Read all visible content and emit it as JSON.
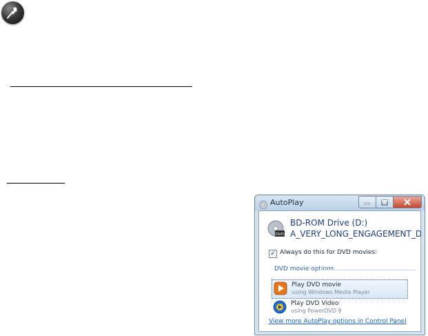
{
  "note": {
    "icon": "note-pin-icon"
  },
  "dialog": {
    "title": "AutoPlay",
    "title_icon": "autoplay-disc-icon",
    "drive_icon": "dvd-drive-icon",
    "drive_name": "BD-ROM Drive (D:)",
    "disc_label": "A_VERY_LONG_ENGAGEMENT_DISC",
    "always_checked": true,
    "always_label": "Always do this for DVD movies:",
    "section_label": "DVD movie options",
    "options": [
      {
        "title": "Play DVD movie",
        "subtitle": "using Windows Media Player",
        "icon": "windows-media-player-icon",
        "selected": true
      },
      {
        "title": "Play DVD Video",
        "subtitle": "using PowerDVD 8",
        "icon": "powerdvd-icon",
        "selected": false
      }
    ],
    "control_panel_link": "View more AutoPlay options in Control Panel"
  }
}
